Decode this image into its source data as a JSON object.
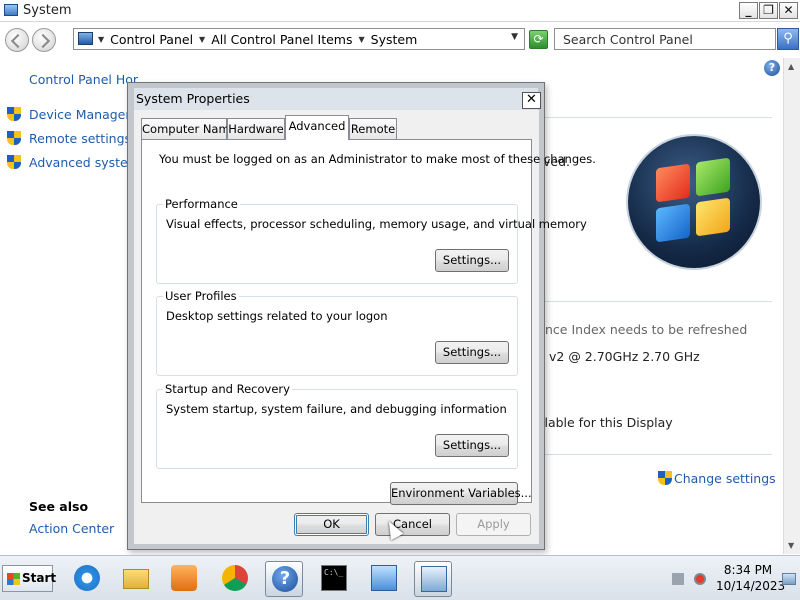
{
  "window": {
    "title": "System",
    "min_glyph": "_",
    "max_glyph": "❐",
    "close_glyph": "✕"
  },
  "address": {
    "crumbs": [
      "Control Panel",
      "All Control Panel Items",
      "System"
    ],
    "search_placeholder": "Search Control Panel"
  },
  "sidebar": {
    "home": "Control Panel Hor",
    "items": [
      {
        "label": "Device Manager",
        "icon": "shield-icon"
      },
      {
        "label": "Remote settings",
        "icon": "shield-icon"
      },
      {
        "label": "Advanced system",
        "icon": "shield-icon"
      }
    ],
    "see_also": "See also",
    "action_center": "Action Center"
  },
  "background_text": {
    "reserved": "ved.",
    "experience_index": "nce Index needs to be refreshed",
    "processor": "v2 @ 2.70GHz   2.70 GHz",
    "pen_touch": "ilable for this Display",
    "change_settings": "Change settings"
  },
  "dialog": {
    "title": "System Properties",
    "close_glyph": "✕",
    "tabs": [
      "Computer Name",
      "Hardware",
      "Advanced",
      "Remote"
    ],
    "active_tab": "Advanced",
    "admin_note": "You must be logged on as an Administrator to make most of these changes.",
    "groups": [
      {
        "title": "Performance",
        "description": "Visual effects, processor scheduling, memory usage, and virtual memory",
        "button": "Settings..."
      },
      {
        "title": "User Profiles",
        "description": "Desktop settings related to your logon",
        "button": "Settings..."
      },
      {
        "title": "Startup and Recovery",
        "description": "System startup, system failure, and debugging information",
        "button": "Settings..."
      }
    ],
    "env_button": "Environment Variables...",
    "ok": "OK",
    "cancel": "Cancel",
    "apply": "Apply"
  },
  "taskbar": {
    "start": "Start",
    "apps": [
      "internet-explorer-icon",
      "folder-icon",
      "media-player-icon",
      "chrome-icon",
      "help-icon",
      "command-prompt-icon",
      "control-panel-icon",
      "system-properties-icon"
    ],
    "time": "8:34 PM",
    "date": "10/14/2023"
  },
  "colors": {
    "link": "#1e5cab",
    "dialog_frame": "#c3c7cc"
  }
}
